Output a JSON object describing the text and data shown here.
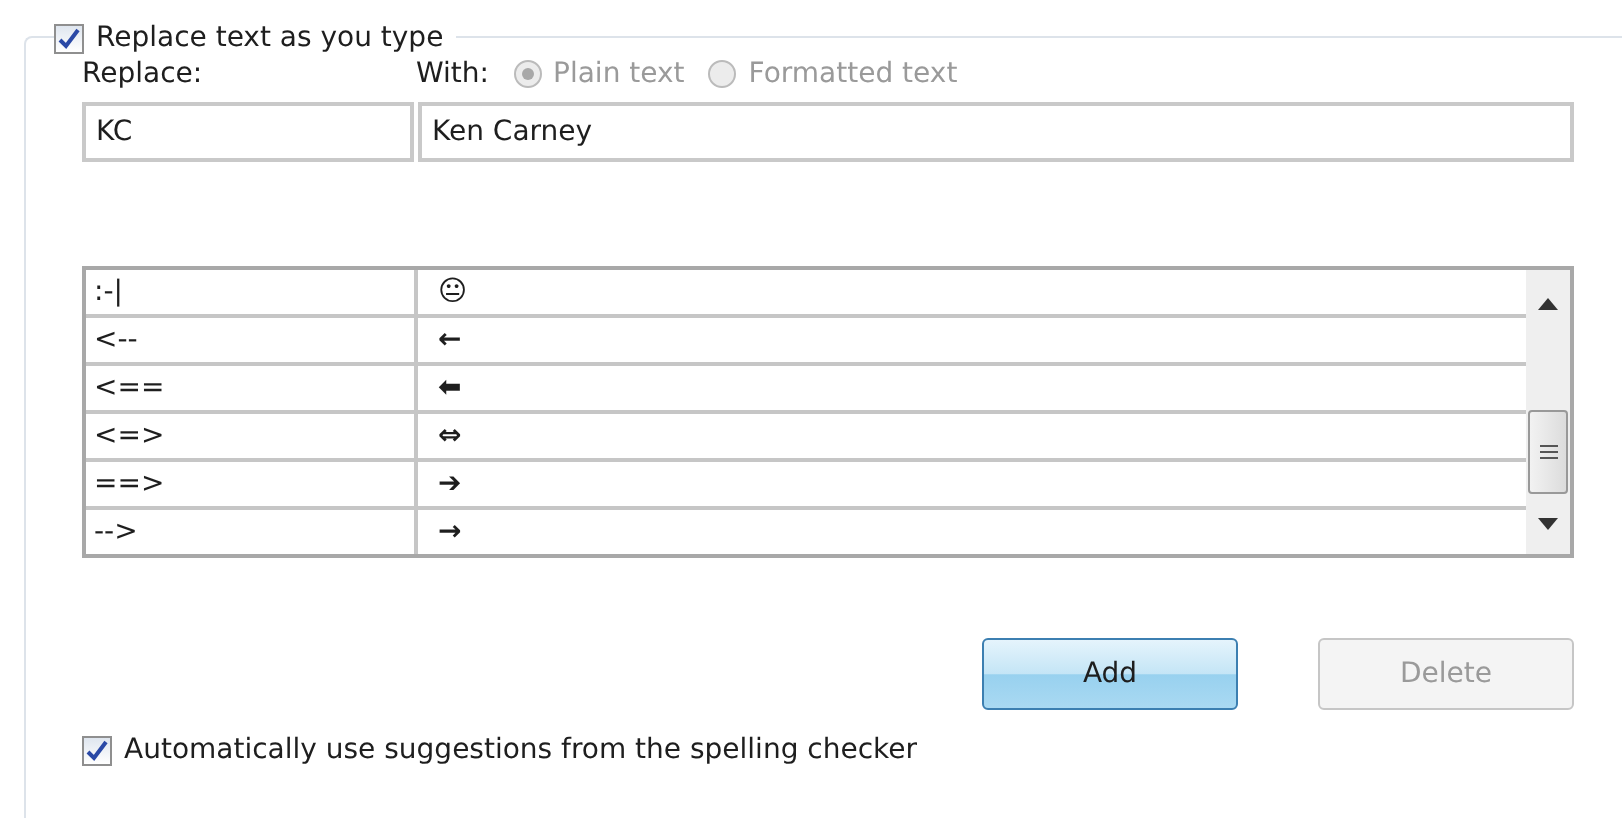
{
  "replace_group": {
    "label": "Replace text as you type",
    "checked": true
  },
  "replace_label": "Replace:",
  "with_label": "With:",
  "format_options": [
    {
      "label": "Plain text",
      "selected": true,
      "disabled": true
    },
    {
      "label": "Formatted text",
      "selected": false,
      "disabled": true
    }
  ],
  "replace_value": "KC",
  "with_value": "Ken Carney",
  "entries": [
    {
      "replace": ":-|",
      "with": "😐"
    },
    {
      "replace": "<--",
      "with": "←"
    },
    {
      "replace": "<==",
      "with": "⬅"
    },
    {
      "replace": "<=>",
      "with": "⇔"
    },
    {
      "replace": "==>",
      "with": "➔"
    },
    {
      "replace": "-->",
      "with": "→"
    }
  ],
  "buttons": [
    {
      "label": "Add",
      "disabled": false
    },
    {
      "label": "Delete",
      "disabled": true
    }
  ],
  "suggestions": {
    "label": "Automatically use suggestions from the spelling checker",
    "checked": true
  }
}
